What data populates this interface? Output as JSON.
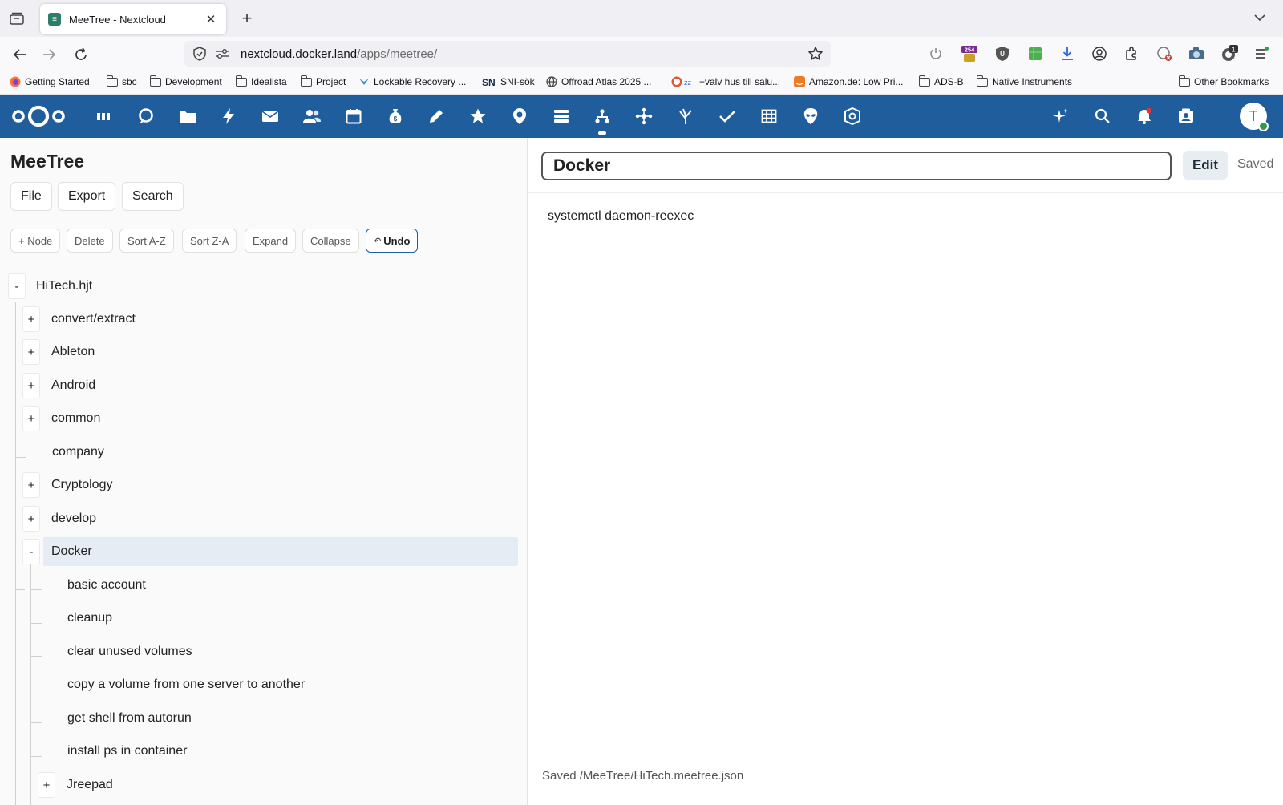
{
  "browser": {
    "tab_title": "MeeTree - Nextcloud",
    "url_host": "nextcloud.docker.land",
    "url_path": "/apps/meetree/",
    "badge_downloads": "254",
    "badge_ext": "1",
    "bookmarks": [
      {
        "label": "Getting Started",
        "icon": "firefox-icon"
      },
      {
        "label": "sbc",
        "icon": "folder-icon"
      },
      {
        "label": "Development",
        "icon": "folder-icon"
      },
      {
        "label": "Idealista",
        "icon": "folder-icon"
      },
      {
        "label": "Project",
        "icon": "folder-icon"
      },
      {
        "label": "Lockable Recovery ...",
        "icon": "bird-icon"
      },
      {
        "label": "SNI-sök",
        "icon": "sni-icon"
      },
      {
        "label": "Offroad Atlas 2025 ...",
        "icon": "globe-icon"
      },
      {
        "label": "+valv hus till salu...",
        "icon": "duck-icon"
      },
      {
        "label": "Amazon.de: Low Pri...",
        "icon": "amazon-icon"
      },
      {
        "label": "ADS-B",
        "icon": "folder-icon"
      },
      {
        "label": "Native Instruments",
        "icon": "folder-icon"
      }
    ],
    "other_bookmarks": "Other Bookmarks"
  },
  "nextcloud": {
    "avatar_initial": "T",
    "header_color": "#1f5d9c"
  },
  "app": {
    "title": "MeeTree",
    "menu": {
      "file": "File",
      "export": "Export",
      "search": "Search"
    },
    "toolbar": {
      "add_node": "+ Node",
      "delete": "Delete",
      "sort_az": "Sort A-Z",
      "sort_za": "Sort Z-A",
      "expand": "Expand",
      "collapse": "Collapse",
      "undo": "Undo"
    },
    "tree": {
      "root": {
        "label": "HiTech.hjt",
        "toggle": "-"
      },
      "children": [
        {
          "label": "convert/extract",
          "toggle": "+"
        },
        {
          "label": "Ableton",
          "toggle": "+"
        },
        {
          "label": "Android",
          "toggle": "+"
        },
        {
          "label": "common",
          "toggle": "+"
        },
        {
          "label": "company",
          "toggle": ""
        },
        {
          "label": "Cryptology",
          "toggle": "+"
        },
        {
          "label": "develop",
          "toggle": "+"
        },
        {
          "label": "Docker",
          "toggle": "-"
        }
      ],
      "docker_children": [
        {
          "label": "basic account"
        },
        {
          "label": "cleanup"
        },
        {
          "label": "clear unused volumes"
        },
        {
          "label": "copy a volume from one server to another"
        },
        {
          "label": "get shell from autorun"
        },
        {
          "label": "install ps in container"
        }
      ],
      "jreepad": {
        "label": "Jreepad",
        "toggle": "+"
      }
    },
    "editor": {
      "title_value": "Docker",
      "edit_label": "Edit",
      "saved_label": "Saved",
      "content": "systemctl daemon-reexec",
      "status": "Saved /MeeTree/HiTech.meetree.json"
    }
  }
}
